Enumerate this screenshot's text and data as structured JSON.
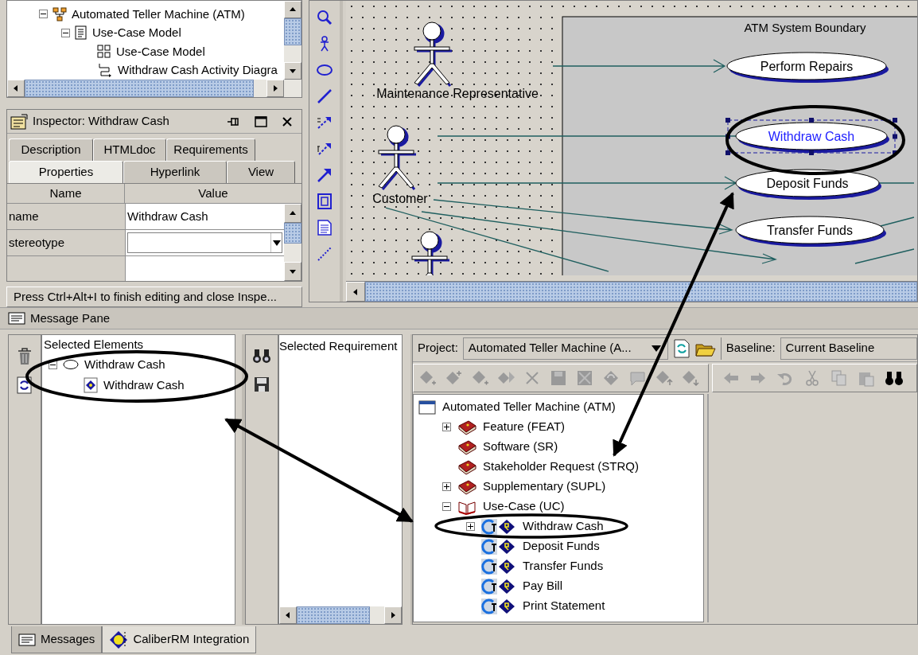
{
  "model_tree": [
    {
      "label": "Automated Teller Machine (ATM)",
      "kind": "hierarchy",
      "expanded": true,
      "children": [
        {
          "label": "Use-Case Model",
          "kind": "document",
          "expanded": true,
          "children": [
            {
              "label": "Use-Case Model",
              "kind": "grid"
            },
            {
              "label": "Withdraw Cash Activity Diagra",
              "kind": "flow"
            }
          ]
        }
      ]
    }
  ],
  "inspector": {
    "title": "Inspector: Withdraw Cash",
    "tabs_row1": [
      {
        "label": "Description",
        "selected": false
      },
      {
        "label": "HTMLdoc",
        "selected": false
      },
      {
        "label": "Requirements",
        "selected": false
      }
    ],
    "tabs_row2": [
      {
        "label": "Properties",
        "selected": true
      },
      {
        "label": "Hyperlink",
        "selected": false
      },
      {
        "label": "View",
        "selected": false
      }
    ],
    "columns": [
      "Name",
      "Value"
    ],
    "properties": [
      {
        "name": "name",
        "value": "Withdraw Cash",
        "kind": "text"
      },
      {
        "name": "stereotype",
        "kind": "dropdown"
      }
    ],
    "hint": "Press Ctrl+Alt+I to finish editing and close Inspe..."
  },
  "diagram": {
    "boundary_title": "ATM System Boundary",
    "actors": [
      {
        "label": "Maintenance Representative"
      },
      {
        "label": "Customer"
      }
    ],
    "use_cases": [
      {
        "label": "Perform Repairs",
        "selected": false
      },
      {
        "label": "Withdraw Cash",
        "selected": true
      },
      {
        "label": "Deposit Funds",
        "selected": false
      },
      {
        "label": "Transfer Funds",
        "selected": false
      }
    ]
  },
  "message_pane": {
    "title": "Message Pane",
    "elements_header": "Selected Elements",
    "elements": [
      {
        "label": "Withdraw Cash",
        "kind": "ellipse",
        "expanded": true,
        "children": [
          {
            "label": "Withdraw Cash",
            "kind": "reqdoc"
          }
        ]
      }
    ],
    "requirements_header": "Selected Requirement"
  },
  "caliber": {
    "project_label": "Project:",
    "project": "Automated Teller Machine (A...",
    "baseline_label": "Baseline:",
    "baseline": "Current Baseline",
    "tree": [
      {
        "label": "Automated Teller Machine (ATM)",
        "kind": "window",
        "children": [
          {
            "label": "Feature (FEAT)",
            "kind": "book",
            "expanded": false
          },
          {
            "label": "Software (SR)",
            "kind": "book"
          },
          {
            "label": "Stakeholder Request (STRQ)",
            "kind": "book"
          },
          {
            "label": "Supplementary (SUPL)",
            "kind": "book",
            "expanded": false
          },
          {
            "label": "Use-Case (UC)",
            "kind": "openbook",
            "expanded": true,
            "children": [
              {
                "label": "Withdraw Cash",
                "kind": "req",
                "expanded": false
              },
              {
                "label": "Deposit Funds",
                "kind": "req"
              },
              {
                "label": "Transfer Funds",
                "kind": "req"
              },
              {
                "label": "Pay Bill",
                "kind": "req"
              },
              {
                "label": "Print Statement",
                "kind": "req"
              }
            ]
          }
        ]
      }
    ]
  },
  "bottom_tabs": [
    {
      "label": "Messages",
      "kind": "messages",
      "selected": false
    },
    {
      "label": "CaliberRM Integration",
      "kind": "caliber",
      "selected": true
    }
  ]
}
